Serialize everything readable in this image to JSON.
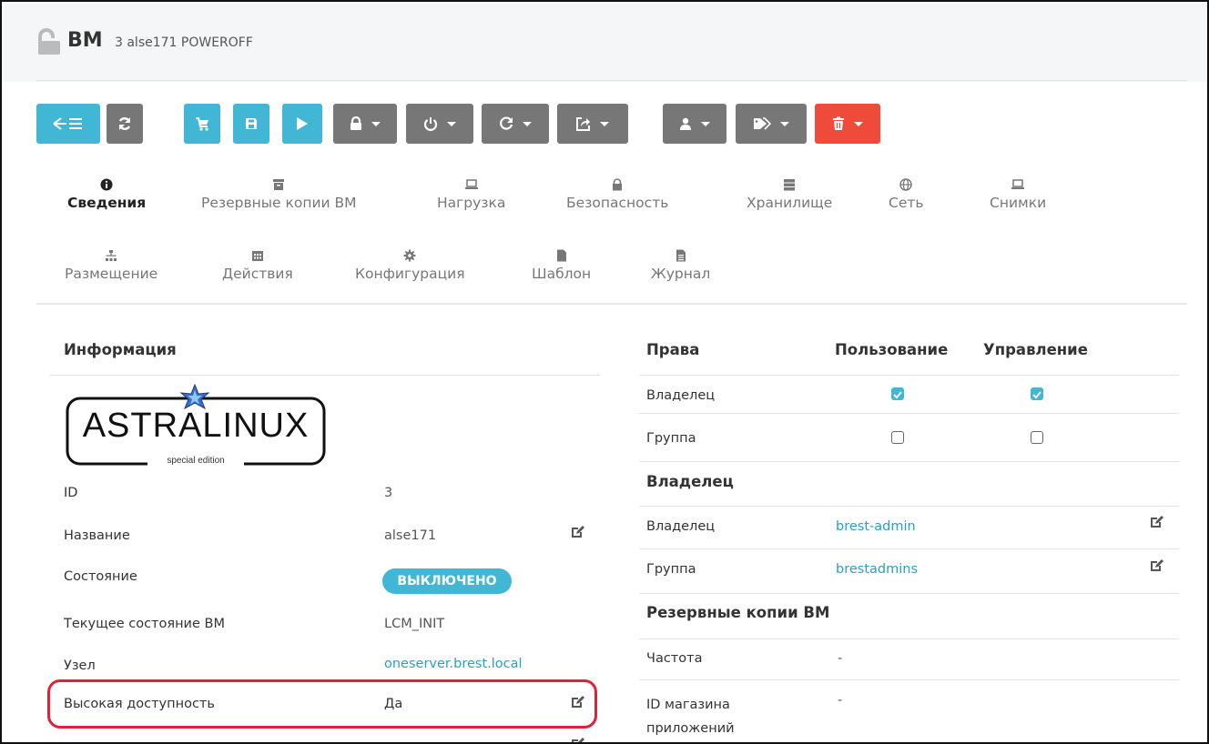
{
  "header": {
    "title": "ВМ",
    "subtitle": "3 alse171 POWEROFF"
  },
  "toolbar": {
    "buttons": [
      {
        "name": "back-to-list",
        "icon": "arrow-left-list-icon",
        "color": "#42b6d5"
      },
      {
        "name": "refresh",
        "icon": "refresh-icon",
        "color": "#777777"
      },
      {
        "name": "marketplace",
        "icon": "cart-icon",
        "color": "#42b6d5"
      },
      {
        "name": "save",
        "icon": "save-icon",
        "color": "#42b6d5"
      },
      {
        "name": "play",
        "icon": "play-icon",
        "color": "#42b6d5"
      },
      {
        "name": "lock-menu",
        "icon": "lock-icon",
        "color": "#777777"
      },
      {
        "name": "power-menu",
        "icon": "power-icon",
        "color": "#777777"
      },
      {
        "name": "restart-menu",
        "icon": "restart-icon",
        "color": "#777777"
      },
      {
        "name": "share-menu",
        "icon": "share-icon",
        "color": "#777777"
      },
      {
        "name": "user-menu",
        "icon": "user-icon",
        "color": "#777777"
      },
      {
        "name": "labels-menu",
        "icon": "tag-icon",
        "color": "#777777"
      },
      {
        "name": "delete-menu",
        "icon": "trash-icon",
        "color": "#ef4b3b"
      }
    ]
  },
  "tabs": [
    {
      "label": "Сведения",
      "icon": "info-icon",
      "active": true
    },
    {
      "label": "Резервные копии ВМ",
      "icon": "archive-icon"
    },
    {
      "label": "Нагрузка",
      "icon": "laptop-icon"
    },
    {
      "label": "Безопасность",
      "icon": "lock-icon"
    },
    {
      "label": "Хранилище",
      "icon": "server-icon"
    },
    {
      "label": "Сеть",
      "icon": "globe-icon"
    },
    {
      "label": "Снимки",
      "icon": "laptop-icon"
    },
    {
      "label": "Размещение",
      "icon": "sitemap-icon"
    },
    {
      "label": "Действия",
      "icon": "calendar-icon"
    },
    {
      "label": "Конфигурация",
      "icon": "gear-icon"
    },
    {
      "label": "Шаблон",
      "icon": "file-icon"
    },
    {
      "label": "Журнал",
      "icon": "file-text-icon"
    }
  ],
  "info": {
    "title": "Информация",
    "logo": {
      "text": "ASTRALINUX",
      "caption": "special edition"
    },
    "rows": [
      {
        "label": "ID",
        "value": "3"
      },
      {
        "label": "Название",
        "value": "alse171"
      },
      {
        "label": "Состояние",
        "value": "ВЫКЛЮЧЕНО"
      },
      {
        "label": "Текущее состояние ВМ",
        "value": "LCM_INIT"
      },
      {
        "label": "Узел",
        "value": "oneserver.brest.local"
      },
      {
        "label": "Высокая доступность",
        "value": "Да"
      }
    ]
  },
  "permissions": {
    "headers": [
      "Права",
      "Пользование",
      "Управление"
    ],
    "rows": [
      {
        "label": "Владелец",
        "use": true,
        "manage": true
      },
      {
        "label": "Группа",
        "use": false,
        "manage": false
      }
    ]
  },
  "owner": {
    "title": "Владелец",
    "rows": [
      {
        "label": "Владелец",
        "value": "brest-admin"
      },
      {
        "label": "Группа",
        "value": "brestadmins"
      }
    ]
  },
  "backups": {
    "title": "Резервные копии ВМ",
    "rows": [
      {
        "label": "Частота",
        "value": "-"
      },
      {
        "label": "ID магазина приложений",
        "value": "-"
      }
    ]
  }
}
